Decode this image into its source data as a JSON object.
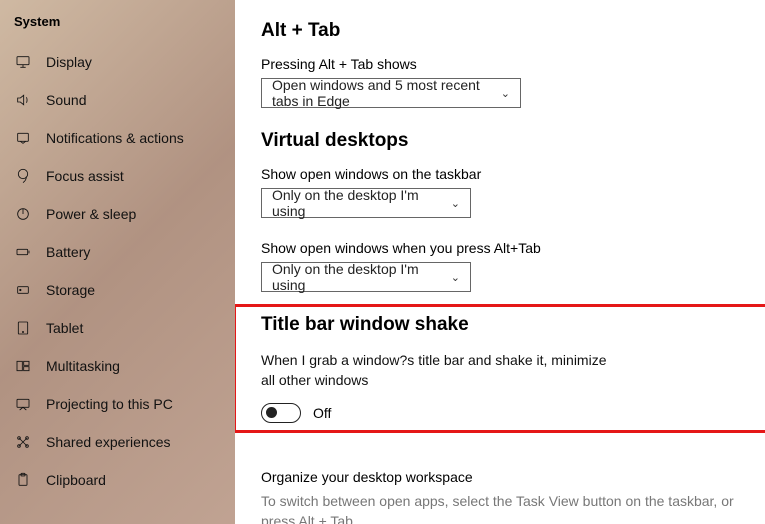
{
  "sidebar": {
    "header": "System",
    "items": [
      {
        "label": "Display",
        "icon": "display-icon"
      },
      {
        "label": "Sound",
        "icon": "sound-icon"
      },
      {
        "label": "Notifications & actions",
        "icon": "notifications-icon"
      },
      {
        "label": "Focus assist",
        "icon": "focus-assist-icon"
      },
      {
        "label": "Power & sleep",
        "icon": "power-icon"
      },
      {
        "label": "Battery",
        "icon": "battery-icon"
      },
      {
        "label": "Storage",
        "icon": "storage-icon"
      },
      {
        "label": "Tablet",
        "icon": "tablet-icon"
      },
      {
        "label": "Multitasking",
        "icon": "multitasking-icon"
      },
      {
        "label": "Projecting to this PC",
        "icon": "projecting-icon"
      },
      {
        "label": "Shared experiences",
        "icon": "shared-icon"
      },
      {
        "label": "Clipboard",
        "icon": "clipboard-icon"
      }
    ]
  },
  "main": {
    "alttab": {
      "title": "Alt + Tab",
      "label": "Pressing Alt + Tab shows",
      "selected": "Open windows and 5 most recent tabs in Edge"
    },
    "vdesktops": {
      "title": "Virtual desktops",
      "field1_label": "Show open windows on the taskbar",
      "field1_selected": "Only on the desktop I'm using",
      "field2_label": "Show open windows when you press Alt+Tab",
      "field2_selected": "Only on the desktop I'm using"
    },
    "shake": {
      "title": "Title bar window shake",
      "description": "When I grab a window?s title bar and shake it, minimize all other windows",
      "toggle_state": "Off"
    },
    "footer": {
      "title": "Organize your desktop workspace",
      "description": "To switch between open apps, select the Task View button on the taskbar, or press Alt + Tab."
    }
  }
}
